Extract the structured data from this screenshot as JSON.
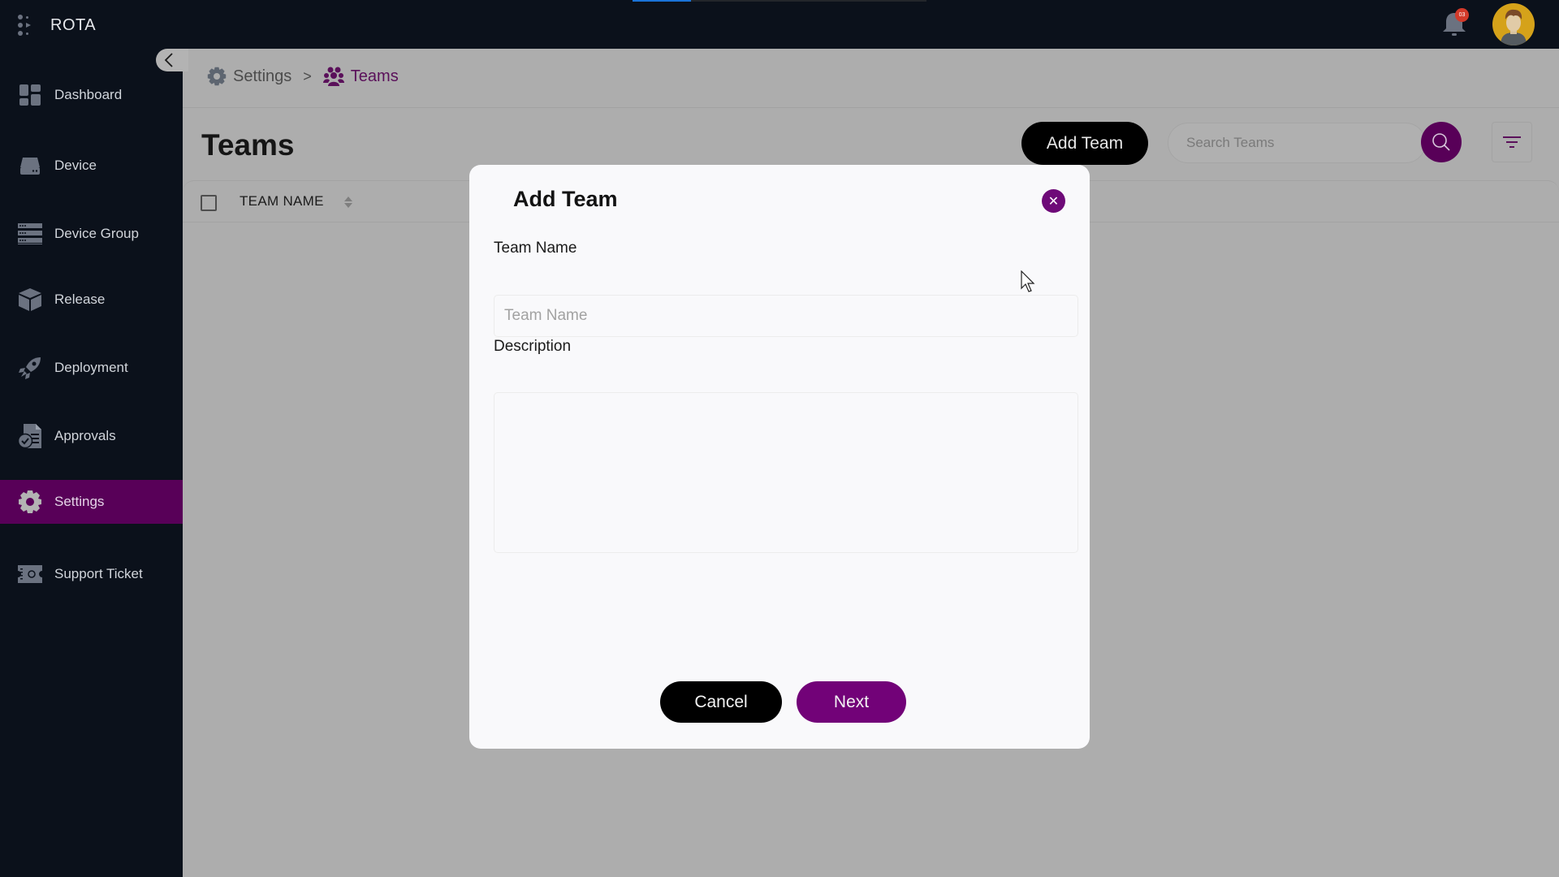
{
  "app": {
    "name": "ROTA",
    "loading_progress_percent": 20,
    "notifications": {
      "badge": "03",
      "badge_color": "#d23a2a"
    }
  },
  "sidebar": {
    "items": [
      {
        "label": "Dashboard",
        "icon": "dashboard-icon",
        "active": false
      },
      {
        "label": "Device",
        "icon": "hard-drive-icon",
        "active": false
      },
      {
        "label": "Device Group",
        "icon": "server-stack-icon",
        "active": false
      },
      {
        "label": "Release",
        "icon": "box-icon",
        "active": false
      },
      {
        "label": "Deployment",
        "icon": "rocket-icon",
        "active": false
      },
      {
        "label": "Approvals",
        "icon": "document-check-icon",
        "active": false
      },
      {
        "label": "Settings",
        "icon": "gear-icon",
        "active": true
      },
      {
        "label": "Support Ticket",
        "icon": "ticket-icon",
        "active": false
      }
    ],
    "active_color": "#580058"
  },
  "breadcrumb": {
    "items": [
      {
        "label": "Settings",
        "icon": "gear-icon"
      },
      {
        "label": "Teams",
        "icon": "users-icon"
      }
    ],
    "separator": ">"
  },
  "page": {
    "title": "Teams",
    "add_button": "Add Team",
    "search": {
      "placeholder": "Search Teams",
      "value": ""
    },
    "table": {
      "columns": [
        {
          "label": "TEAM NAME",
          "sortable": true
        }
      ],
      "rows": []
    }
  },
  "modal": {
    "title": "Add Team",
    "fields": {
      "team_name": {
        "label": "Team Name",
        "placeholder": "Team Name",
        "value": ""
      },
      "description": {
        "label": "Description",
        "value": ""
      }
    },
    "buttons": {
      "cancel": "Cancel",
      "next": "Next"
    },
    "accent_color": "#720278"
  }
}
